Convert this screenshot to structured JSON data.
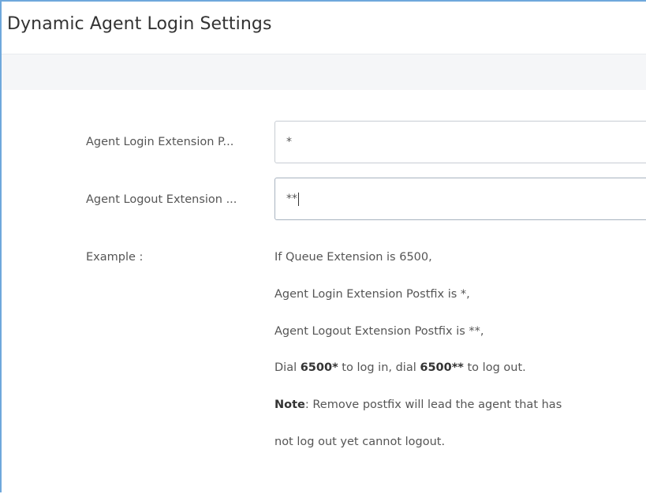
{
  "header": {
    "title": "Dynamic Agent Login Settings"
  },
  "form": {
    "login_label": "Agent Login Extension P...",
    "login_value": "*",
    "logout_label": "Agent Logout Extension ...",
    "logout_value": "**"
  },
  "example": {
    "label": "Example :",
    "line1": "If Queue Extension is 6500,",
    "line2": "Agent Login Extension Postfix is *,",
    "line3": "Agent Logout Extension Postfix is **,",
    "line4_pre": "Dial ",
    "line4_b1": "6500*",
    "line4_mid": " to log in, dial ",
    "line4_b2": "6500**",
    "line4_post": " to log out.",
    "note_label": "Note",
    "note_text": ": Remove postfix will lead the agent that has",
    "line6": "not log out yet cannot logout."
  },
  "colors": {
    "frame_border": "#6fa8dc",
    "strip_bg": "#f5f6f8",
    "text": "#555555"
  }
}
